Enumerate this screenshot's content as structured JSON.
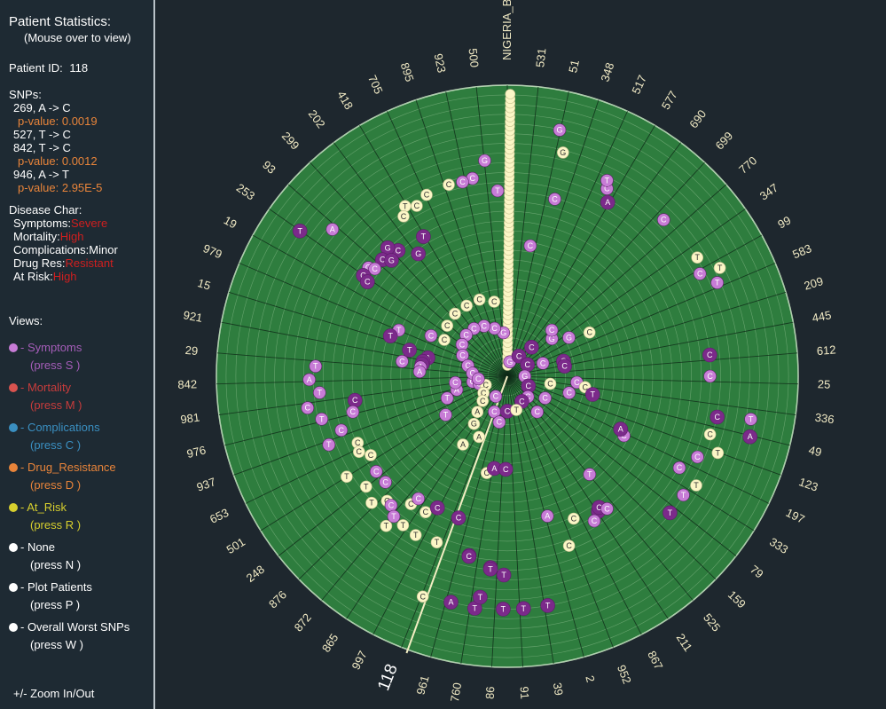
{
  "sidebar": {
    "title": "Patient Statistics:",
    "subtitle": "(Mouse over to view)",
    "patient_id_label": "Patient ID:",
    "patient_id_value": "118",
    "snps_label": "SNPs:",
    "snps": [
      {
        "mutation": "269, A -> C",
        "pvalue": "p-value: 0.0019"
      },
      {
        "mutation": "527, T -> C",
        "pvalue": null
      },
      {
        "mutation": "842, T -> C",
        "pvalue": "p-value: 0.0012"
      },
      {
        "mutation": "946, A -> T",
        "pvalue": "p-value: 2.95E-5"
      }
    ],
    "disease_label": "Disease Char:",
    "disease": [
      {
        "label": "Symptoms:",
        "value": "Severe",
        "highlight": true
      },
      {
        "label": "Mortality:",
        "value": "High",
        "highlight": true
      },
      {
        "label": "Complications:",
        "value": "Minor",
        "highlight": false
      },
      {
        "label": "Drug Res:",
        "value": "Resistant",
        "highlight": true
      },
      {
        "label": "At Risk:",
        "value": "High",
        "highlight": true
      }
    ],
    "views_label": "Views:",
    "views": [
      {
        "name": "- Symptoms",
        "key": "(press S )",
        "color": "#c77cd6"
      },
      {
        "name": "- Mortality",
        "key": "(press M )",
        "color": "#d9534f"
      },
      {
        "name": "- Complications",
        "key": "(press C )",
        "color": "#3a8fc1"
      },
      {
        "name": "- Drug_Resistance",
        "key": "(press D )",
        "color": "#e8843a"
      },
      {
        "name": "- At_Risk",
        "key": "(press R )",
        "color": "#d7cf2e"
      },
      {
        "name": "- None",
        "key": "(press N )",
        "color": "#ffffff"
      },
      {
        "name": "- Plot Patients",
        "key": "(press P )",
        "color": "#ffffff"
      },
      {
        "name": "- Overall Worst SNPs",
        "key": "(press W )",
        "color": "#ffffff"
      }
    ],
    "zoom_hint": "+/- Zoom In/Out"
  },
  "colors": {
    "circle_fill": "#2e7d3e",
    "ring_line": "#79b07d",
    "spoke_line": "#0f2a18",
    "highlight_line": "#f3eec3",
    "purple_dark": "#7b2a8a",
    "purple_light": "#c77cd6",
    "cream": "#fbf6c6"
  },
  "chart_data": {
    "type": "scatter",
    "title": "",
    "top_label": "NIGERIA_B",
    "highlighted_patient": "118",
    "spoke_labels": [
      "531",
      "51",
      "348",
      "517",
      "577",
      "690",
      "699",
      "770",
      "347",
      "99",
      "583",
      "209",
      "445",
      "612",
      "25",
      "336",
      "49",
      "123",
      "197",
      "333",
      "79",
      "159",
      "525",
      "211",
      "867",
      "952",
      "2",
      "39",
      "91",
      "86",
      "760",
      "961",
      "118",
      "997",
      "865",
      "872",
      "876",
      "248",
      "501",
      "653",
      "937",
      "976",
      "981",
      "842",
      "29",
      "921",
      "15",
      "979",
      "19",
      "253",
      "93",
      "299",
      "202",
      "418",
      "705",
      "895",
      "923",
      "500"
    ],
    "marks": [
      {
        "a": 12,
        "r": 0.865,
        "n": "G",
        "t": 1
      },
      {
        "a": 14,
        "r": 0.792,
        "n": "G",
        "t": 0
      },
      {
        "a": -6,
        "r": 0.745,
        "n": "G",
        "t": 1
      },
      {
        "a": -10,
        "r": 0.69,
        "n": "C",
        "t": 1
      },
      {
        "a": -13,
        "r": 0.685,
        "n": "C",
        "t": 1
      },
      {
        "a": -17,
        "r": 0.688,
        "n": "C",
        "t": 0
      },
      {
        "a": -3,
        "r": 0.638,
        "n": "T",
        "t": 1
      },
      {
        "a": -24,
        "r": 0.682,
        "n": "C",
        "t": 0
      },
      {
        "a": -28,
        "r": 0.663,
        "n": "C",
        "t": 0
      },
      {
        "a": -31,
        "r": 0.682,
        "n": "T",
        "t": 0
      },
      {
        "a": -33,
        "r": 0.655,
        "n": "C",
        "t": 0
      },
      {
        "a": -50,
        "r": 0.785,
        "n": "A",
        "t": 1
      },
      {
        "a": -41,
        "r": 0.572,
        "n": "C",
        "t": 2
      },
      {
        "a": -43,
        "r": 0.603,
        "n": "G",
        "t": 2
      },
      {
        "a": -47,
        "r": 0.587,
        "n": "C",
        "t": 2
      },
      {
        "a": -45,
        "r": 0.563,
        "n": "G",
        "t": 2
      },
      {
        "a": -52,
        "r": 0.606,
        "n": "G",
        "t": 1
      },
      {
        "a": -51,
        "r": 0.586,
        "n": "C",
        "t": 1
      },
      {
        "a": -55,
        "r": 0.604,
        "n": "G",
        "t": 2
      },
      {
        "a": -56,
        "r": 0.58,
        "n": "C",
        "t": 2
      },
      {
        "a": -31,
        "r": 0.56,
        "n": "T",
        "t": 2
      },
      {
        "a": -36,
        "r": 0.52,
        "n": "G",
        "t": 2
      },
      {
        "a": -55,
        "r": 0.87,
        "n": "T",
        "t": 2
      },
      {
        "a": -67,
        "r": 0.405,
        "n": "T",
        "t": 1
      },
      {
        "a": -71,
        "r": 0.425,
        "n": "T",
        "t": 2
      },
      {
        "a": -62,
        "r": 0.297,
        "n": "C",
        "t": 1
      },
      {
        "a": -75,
        "r": 0.348,
        "n": "T",
        "t": 2
      },
      {
        "a": -77,
        "r": 0.28,
        "n": "A",
        "t": 2
      },
      {
        "a": -80,
        "r": 0.294,
        "n": "C",
        "t": 2
      },
      {
        "a": -82,
        "r": 0.296,
        "n": "C",
        "t": 2
      },
      {
        "a": -82,
        "r": 0.365,
        "n": "C",
        "t": 1
      },
      {
        "a": -84,
        "r": 0.3,
        "n": "A",
        "t": 1
      },
      {
        "a": -87,
        "r": 0.302,
        "n": "A",
        "t": 1
      },
      {
        "a": -87,
        "r": 0.66,
        "n": "T",
        "t": 1
      },
      {
        "a": -91,
        "r": 0.681,
        "n": "A",
        "t": 1
      },
      {
        "a": -99,
        "r": 0.695,
        "n": "C",
        "t": 1
      },
      {
        "a": -95,
        "r": 0.648,
        "n": "T",
        "t": 1
      },
      {
        "a": -99,
        "r": 0.53,
        "n": "C",
        "t": 2
      },
      {
        "a": -103,
        "r": 0.545,
        "n": "C",
        "t": 1
      },
      {
        "a": -103,
        "r": 0.655,
        "n": "T",
        "t": 1
      },
      {
        "a": -108,
        "r": 0.6,
        "n": "C",
        "t": 1
      },
      {
        "a": -111,
        "r": 0.657,
        "n": "T",
        "t": 1
      },
      {
        "a": -114,
        "r": 0.563,
        "n": "C",
        "t": 0
      },
      {
        "a": -117,
        "r": 0.572,
        "n": "C",
        "t": 0
      },
      {
        "a": -120,
        "r": 0.542,
        "n": "C",
        "t": 0
      },
      {
        "a": -122,
        "r": 0.651,
        "n": "T",
        "t": 0
      },
      {
        "a": -126,
        "r": 0.557,
        "n": "C",
        "t": 1
      },
      {
        "a": -128,
        "r": 0.616,
        "n": "T",
        "t": 0
      },
      {
        "a": -131,
        "r": 0.555,
        "n": "C",
        "t": 1
      },
      {
        "a": -133,
        "r": 0.638,
        "n": "T",
        "t": 0
      },
      {
        "a": -136,
        "r": 0.595,
        "n": "C",
        "t": 0
      },
      {
        "a": -138,
        "r": 0.597,
        "n": "C",
        "t": 1
      },
      {
        "a": -141,
        "r": 0.662,
        "n": "T",
        "t": 0
      },
      {
        "a": -141,
        "r": 0.62,
        "n": "T",
        "t": 1
      },
      {
        "a": -143,
        "r": 0.55,
        "n": "C",
        "t": 0
      },
      {
        "a": -145,
        "r": 0.625,
        "n": "T",
        "t": 0
      },
      {
        "a": -150,
        "r": 0.63,
        "n": "T",
        "t": 0
      },
      {
        "a": -144,
        "r": 0.52,
        "n": "C",
        "t": 1
      },
      {
        "a": -149,
        "r": 0.545,
        "n": "C",
        "t": 0
      },
      {
        "a": -152,
        "r": 0.512,
        "n": "C",
        "t": 2
      },
      {
        "a": -157,
        "r": 0.62,
        "n": "T",
        "t": 0
      },
      {
        "a": -161,
        "r": 0.515,
        "n": "C",
        "t": 2
      },
      {
        "a": -159,
        "r": 0.811,
        "n": "C",
        "t": 0
      },
      {
        "a": -168,
        "r": 0.63,
        "n": "T",
        "t": 2
      },
      {
        "a": -175,
        "r": 0.66,
        "n": "T",
        "t": 2
      },
      {
        "a": -179,
        "r": 0.683,
        "n": "T",
        "t": 2
      },
      {
        "a": -175,
        "r": 0.665,
        "n": "T",
        "t": 2
      },
      {
        "a": -168,
        "r": 0.633,
        "n": "C",
        "t": 2
      },
      {
        "a": -168,
        "r": 0.34,
        "n": "C",
        "t": 0
      },
      {
        "a": -172,
        "r": 0.32,
        "n": "A",
        "t": 2
      },
      {
        "a": -179,
        "r": 0.32,
        "n": "C",
        "t": 2
      },
      {
        "a": -147,
        "r": 0.28,
        "n": "A",
        "t": 0
      },
      {
        "a": -145,
        "r": 0.2,
        "n": "G",
        "t": 0
      },
      {
        "a": -155,
        "r": 0.23,
        "n": "A",
        "t": 0
      },
      {
        "a": -122,
        "r": 0.25,
        "n": "T",
        "t": 1
      },
      {
        "a": -110,
        "r": 0.22,
        "n": "T",
        "t": 1
      },
      {
        "a": -105,
        "r": 0.18,
        "n": "A",
        "t": 1
      },
      {
        "a": -97,
        "r": 0.18,
        "n": "C",
        "t": 1
      },
      {
        "a": -99,
        "r": 0.12,
        "n": "G",
        "t": 1
      },
      {
        "a": -105,
        "r": 0.1,
        "n": "C",
        "t": 1
      },
      {
        "a": -112,
        "r": 0.08,
        "n": "C",
        "t": 0
      },
      {
        "a": -125,
        "r": 0.1,
        "n": "C",
        "t": 0
      },
      {
        "a": -135,
        "r": 0.12,
        "n": "C",
        "t": 0
      },
      {
        "a": -140,
        "r": 0.16,
        "n": "A",
        "t": 0
      },
      {
        "a": -150,
        "r": 0.08,
        "n": "C",
        "t": 1
      },
      {
        "a": -160,
        "r": 0.13,
        "n": "C",
        "t": 1
      },
      {
        "a": -170,
        "r": 0.16,
        "n": "C",
        "t": 1
      },
      {
        "a": -180,
        "r": 0.12,
        "n": "C",
        "t": 2
      },
      {
        "a": -5,
        "r": 0.15,
        "n": "G",
        "t": 1
      },
      {
        "a": -15,
        "r": 0.17,
        "n": "C",
        "t": 1
      },
      {
        "a": -25,
        "r": 0.19,
        "n": "C",
        "t": 1
      },
      {
        "a": -35,
        "r": 0.2,
        "n": "C",
        "t": 1
      },
      {
        "a": -45,
        "r": 0.2,
        "n": "C",
        "t": 1
      },
      {
        "a": -55,
        "r": 0.19,
        "n": "C",
        "t": 1
      },
      {
        "a": -65,
        "r": 0.17,
        "n": "C",
        "t": 1
      },
      {
        "a": -75,
        "r": 0.14,
        "n": "C",
        "t": 1
      },
      {
        "a": -85,
        "r": 0.12,
        "n": "C",
        "t": 1
      },
      {
        "a": -95,
        "r": 0.1,
        "n": "C",
        "t": 1
      },
      {
        "a": -10,
        "r": 0.26,
        "n": "C",
        "t": 0
      },
      {
        "a": -20,
        "r": 0.28,
        "n": "C",
        "t": 0
      },
      {
        "a": -30,
        "r": 0.28,
        "n": "C",
        "t": 0
      },
      {
        "a": -40,
        "r": 0.28,
        "n": "C",
        "t": 0
      },
      {
        "a": -50,
        "r": 0.27,
        "n": "C",
        "t": 0
      },
      {
        "a": -60,
        "r": 0.25,
        "n": "C",
        "t": 0
      },
      {
        "a": 10,
        "r": 0.05,
        "n": "G",
        "t": 1
      },
      {
        "a": 30,
        "r": 0.08,
        "n": "C",
        "t": 2
      },
      {
        "a": 60,
        "r": 0.08,
        "n": "C",
        "t": 2
      },
      {
        "a": 90,
        "r": 0.06,
        "n": "G",
        "t": 1
      },
      {
        "a": 115,
        "r": 0.08,
        "n": "C",
        "t": 2
      },
      {
        "a": 135,
        "r": 0.1,
        "n": "C",
        "t": 1
      },
      {
        "a": 150,
        "r": 0.1,
        "n": "C",
        "t": 2
      },
      {
        "a": 165,
        "r": 0.12,
        "n": "T",
        "t": 0
      },
      {
        "a": 40,
        "r": 0.13,
        "n": "C",
        "t": 2
      },
      {
        "a": 70,
        "r": 0.13,
        "n": "C",
        "t": 1
      },
      {
        "a": 100,
        "r": 0.15,
        "n": "C",
        "t": 0
      },
      {
        "a": 120,
        "r": 0.15,
        "n": "C",
        "t": 1
      },
      {
        "a": 140,
        "r": 0.16,
        "n": "C",
        "t": 1
      },
      {
        "a": 50,
        "r": 0.2,
        "n": "G",
        "t": 1
      },
      {
        "a": 75,
        "r": 0.2,
        "n": "C",
        "t": 2
      },
      {
        "a": 105,
        "r": 0.22,
        "n": "C",
        "t": 1
      },
      {
        "a": 95,
        "r": 0.24,
        "n": "C",
        "t": 1
      },
      {
        "a": 98,
        "r": 0.27,
        "n": "C",
        "t": 0
      },
      {
        "a": 102,
        "r": 0.3,
        "n": "T",
        "t": 2
      },
      {
        "a": 44,
        "r": 0.22,
        "n": "C",
        "t": 1
      },
      {
        "a": 58,
        "r": 0.25,
        "n": "G",
        "t": 1
      },
      {
        "a": 62,
        "r": 0.32,
        "n": "C",
        "t": 0
      },
      {
        "a": 80,
        "r": 0.2,
        "n": "C",
        "t": 2
      },
      {
        "a": 10,
        "r": 0.455,
        "n": "C",
        "t": 1
      },
      {
        "a": 15,
        "r": 0.63,
        "n": "C",
        "t": 1
      },
      {
        "a": 28,
        "r": 0.73,
        "n": "C",
        "t": 1
      },
      {
        "a": 30,
        "r": 0.69,
        "n": "A",
        "t": 2
      },
      {
        "a": 27,
        "r": 0.755,
        "n": "T",
        "t": 1
      },
      {
        "a": 45,
        "r": 0.76,
        "n": "C",
        "t": 1
      },
      {
        "a": 58,
        "r": 0.77,
        "n": "T",
        "t": 0
      },
      {
        "a": 62,
        "r": 0.75,
        "n": "C",
        "t": 1
      },
      {
        "a": 63,
        "r": 0.82,
        "n": "T",
        "t": 0
      },
      {
        "a": 66,
        "r": 0.79,
        "n": "T",
        "t": 1
      },
      {
        "a": 84,
        "r": 0.7,
        "n": "C",
        "t": 2
      },
      {
        "a": 90,
        "r": 0.697,
        "n": "C",
        "t": 1
      },
      {
        "a": 100,
        "r": 0.85,
        "n": "T",
        "t": 1
      },
      {
        "a": 104,
        "r": 0.86,
        "n": "A",
        "t": 2
      },
      {
        "a": 101,
        "r": 0.735,
        "n": "C",
        "t": 2
      },
      {
        "a": 106,
        "r": 0.725,
        "n": "C",
        "t": 0
      },
      {
        "a": 110,
        "r": 0.77,
        "n": "T",
        "t": 0
      },
      {
        "a": 113,
        "r": 0.71,
        "n": "C",
        "t": 1
      },
      {
        "a": 118,
        "r": 0.67,
        "n": "C",
        "t": 1
      },
      {
        "a": 120,
        "r": 0.75,
        "n": "T",
        "t": 0
      },
      {
        "a": 124,
        "r": 0.73,
        "n": "T",
        "t": 1
      },
      {
        "a": 130,
        "r": 0.73,
        "n": "T",
        "t": 2
      },
      {
        "a": 117,
        "r": 0.45,
        "n": "C",
        "t": 1
      },
      {
        "a": 115,
        "r": 0.43,
        "n": "A",
        "t": 2
      },
      {
        "a": 140,
        "r": 0.44,
        "n": "T",
        "t": 1
      },
      {
        "a": 146,
        "r": 0.56,
        "n": "G",
        "t": 2
      },
      {
        "a": 145,
        "r": 0.55,
        "n": "C",
        "t": 2
      },
      {
        "a": 143,
        "r": 0.57,
        "n": "C",
        "t": 1
      },
      {
        "a": 149,
        "r": 0.58,
        "n": "C",
        "t": 1
      },
      {
        "a": 155,
        "r": 0.54,
        "n": "C",
        "t": 0
      },
      {
        "a": 164,
        "r": 0.5,
        "n": "A",
        "t": 1
      },
      {
        "a": 160,
        "r": 0.62,
        "n": "C",
        "t": 0
      },
      {
        "a": 170,
        "r": 0.8,
        "n": "T",
        "t": 2
      },
      {
        "a": 176,
        "r": 0.8,
        "n": "T",
        "t": 2
      },
      {
        "a": -179,
        "r": 0.8,
        "n": "T",
        "t": 2
      },
      {
        "a": -172,
        "r": 0.805,
        "n": "T",
        "t": 2
      },
      {
        "a": -166,
        "r": 0.8,
        "n": "A",
        "t": 2
      },
      {
        "a": -173,
        "r": 0.765,
        "n": "T",
        "t": 2
      }
    ],
    "patient_trail_points": 60
  }
}
